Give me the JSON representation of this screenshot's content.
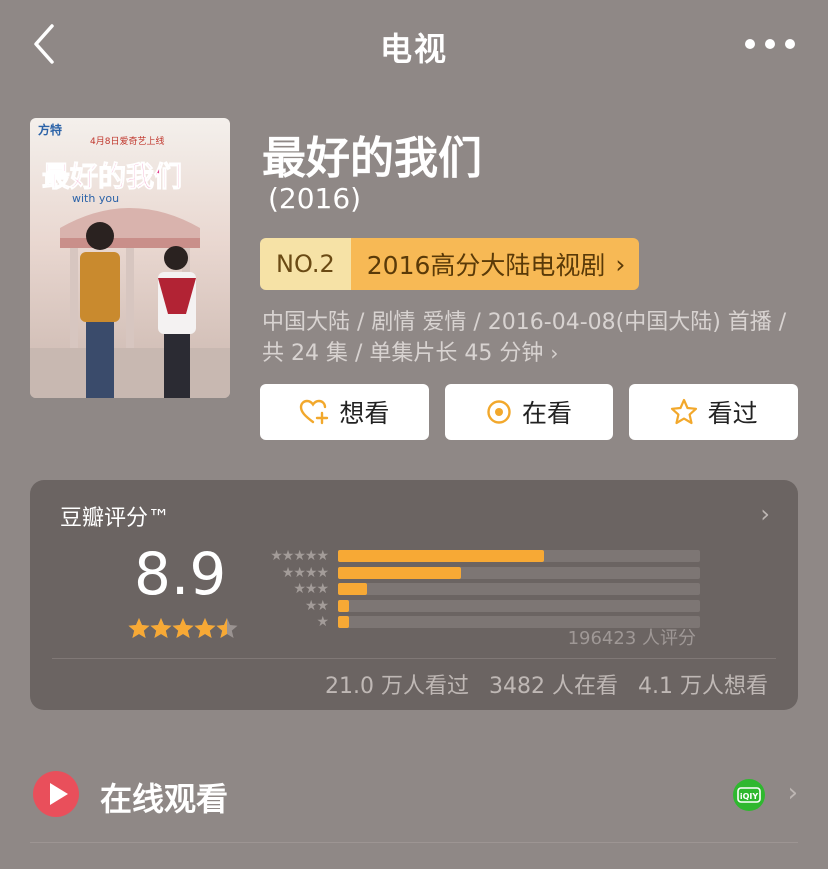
{
  "nav": {
    "title": "电视"
  },
  "movie": {
    "title": "最好的我们",
    "year": "(2016)",
    "poster": {
      "logo": "方特",
      "date_line": "4月8日爱奇艺上线",
      "title_art": "最好的我们",
      "subtitle_art": "with you"
    }
  },
  "rank": {
    "number": "NO.2",
    "label": "2016高分大陆电视剧"
  },
  "meta": {
    "text": "中国大陆 / 剧情 爱情 / 2016-04-08(中国大陆) 首播 / 共 24 集 / 单集片长 45 分钟"
  },
  "actions": [
    {
      "label": "想看",
      "icon": "heart-plus-icon"
    },
    {
      "label": "在看",
      "icon": "target-icon"
    },
    {
      "label": "看过",
      "icon": "star-outline-icon"
    }
  ],
  "rating": {
    "label": "豆瓣评分™",
    "score": "8.9",
    "stars": 4.5,
    "distribution": [
      0.57,
      0.34,
      0.08,
      0.03,
      0.03
    ],
    "count_text": "196423 人评分",
    "watched": "21.0 万人看过",
    "watching": "3482 人在看",
    "wish": "4.1 万人想看"
  },
  "online": {
    "label": "在线观看",
    "provider": "iQIY"
  },
  "colors": {
    "accent": "#f7a935",
    "play": "#e94f5b",
    "iqiyi": "#2fb82f",
    "rank_light": "#f6e2a6",
    "rank_dark": "#f7b955"
  }
}
